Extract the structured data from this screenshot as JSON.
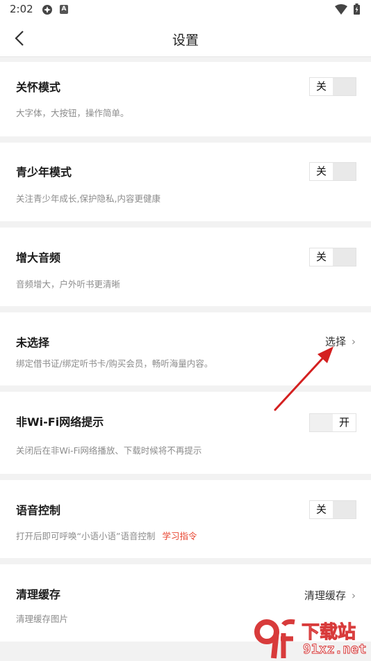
{
  "status_bar": {
    "time": "2:02",
    "notif_letter": "A"
  },
  "header": {
    "title": "设置"
  },
  "sections": [
    {
      "title": "关怀模式",
      "desc": "大字体，大按钮，操作简单。",
      "toggle_label": "关",
      "toggle_state": "off"
    },
    {
      "title": "青少年模式",
      "desc": "关注青少年成长,保护隐私,内容更健康",
      "toggle_label": "关",
      "toggle_state": "off"
    },
    {
      "title": "增大音频",
      "desc": "音频增大，户外听书更清晰",
      "toggle_label": "关",
      "toggle_state": "off"
    },
    {
      "title": "未选择",
      "desc": "绑定借书证/绑定听书卡/购买会员，畅听海量内容。",
      "action_label": "选择"
    },
    {
      "title": "非Wi-Fi网络提示",
      "desc": "关闭后在非Wi-Fi网络播放、下载时候将不再提示",
      "toggle_label": "开",
      "toggle_state": "on"
    },
    {
      "title": "语音控制",
      "desc": "打开后即可呼唤“小语小语”语音控制",
      "link_label": "学习指令",
      "toggle_label": "关",
      "toggle_state": "off"
    },
    {
      "title": "清理缓存",
      "desc": "清理缓存图片",
      "action_label": "清理缓存"
    }
  ],
  "annotation": {
    "arrow_color": "#d42020"
  },
  "watermark": {
    "logo_mark": "9f",
    "site_name": "下载站",
    "domain": "91xz.net"
  }
}
